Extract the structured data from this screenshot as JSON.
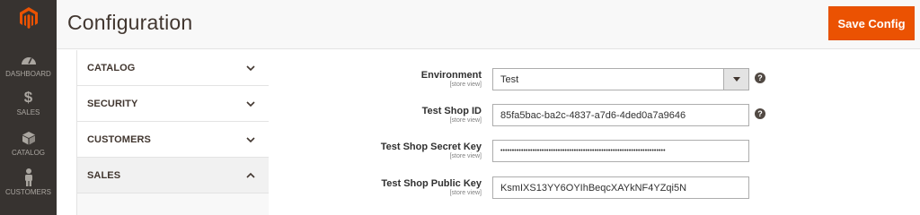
{
  "header": {
    "title": "Configuration",
    "save_label": "Save Config"
  },
  "nav": {
    "items": [
      {
        "label": "DASHBOARD",
        "icon": "dashboard-icon"
      },
      {
        "label": "SALES",
        "icon": "dollar-icon"
      },
      {
        "label": "CATALOG",
        "icon": "box-icon"
      },
      {
        "label": "CUSTOMERS",
        "icon": "person-icon"
      }
    ]
  },
  "tabs": [
    {
      "label": "CATALOG",
      "state": "collapsed"
    },
    {
      "label": "SECURITY",
      "state": "collapsed"
    },
    {
      "label": "CUSTOMERS",
      "state": "collapsed"
    },
    {
      "label": "SALES",
      "state": "expanded"
    }
  ],
  "form": {
    "environment": {
      "label": "Environment",
      "scope": "[store view]",
      "value": "Test"
    },
    "shop_id": {
      "label": "Test Shop ID",
      "scope": "[store view]",
      "value": "85fa5bac-ba2c-4837-a7d6-4ded0a7a9646"
    },
    "secret_key": {
      "label": "Test Shop Secret Key",
      "scope": "[store view]",
      "value": "••••••••••••••••••••••••••••••••••••••••••••••••••••••••••••••••••••••••"
    },
    "public_key": {
      "label": "Test Shop Public Key",
      "scope": "[store view]",
      "value": "KsmIXS13YY6OYIhBeqcXAYkNF4YZqi5N"
    }
  },
  "help_glyph": "?",
  "colors": {
    "nav_bg": "#373330",
    "accent": "#eb5202",
    "logo": "#eb5202"
  }
}
